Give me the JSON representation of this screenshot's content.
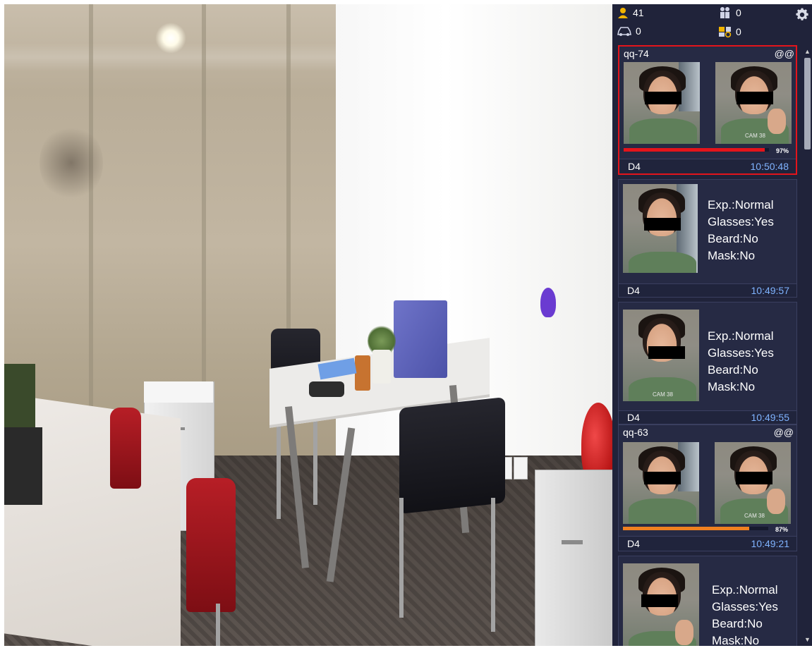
{
  "stats": {
    "face_count": "41",
    "people_count": "0",
    "vehicle_count": "0",
    "plate_count": "0"
  },
  "icons": {
    "face": "person-face-icon",
    "people": "people-counting-icon",
    "vehicle": "vehicle-icon",
    "plate": "plate-recognition-icon",
    "settings": "gear-icon"
  },
  "captures": [
    {
      "type": "match",
      "name": "qq-74",
      "tag": "@@",
      "similarity_value": 97,
      "similarity_label": "97%",
      "channel": "D4",
      "time": "10:50:48",
      "selected": true,
      "bar_color": "#e4141b"
    },
    {
      "type": "attributes",
      "attributes": [
        "Exp.:Normal",
        "Glasses:Yes",
        "Beard:No",
        "Mask:No"
      ],
      "channel": "D4",
      "time": "10:49:57"
    },
    {
      "type": "attributes",
      "attributes": [
        "Exp.:Normal",
        "Glasses:Yes",
        "Beard:No",
        "Mask:No"
      ],
      "channel": "D4",
      "time": "10:49:55"
    },
    {
      "type": "match",
      "name": "qq-63",
      "tag": "@@",
      "similarity_value": 87,
      "similarity_label": "87%",
      "channel": "D4",
      "time": "10:49:21",
      "selected": false,
      "bar_color": "#f08020"
    },
    {
      "type": "attributes",
      "attributes": [
        "Exp.:Normal",
        "Glasses:Yes",
        "Beard:No",
        "Mask:No"
      ]
    }
  ],
  "colors": {
    "panel_bg": "#20233a",
    "highlight": "#e4141b",
    "time_text": "#7fb3ff",
    "icon_accent": "#f2b400"
  }
}
